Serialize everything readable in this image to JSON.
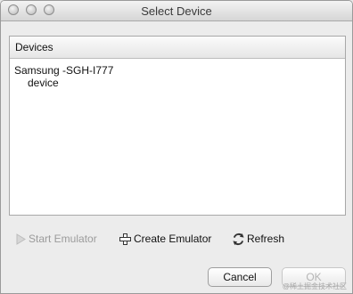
{
  "window": {
    "title": "Select Device"
  },
  "devices_panel": {
    "header": "Devices",
    "items": [
      {
        "name": "Samsung -SGH-I777",
        "serial": "device"
      }
    ]
  },
  "actions": {
    "start_emulator": "Start Emulator",
    "create_emulator": "Create Emulator",
    "refresh": "Refresh"
  },
  "buttons": {
    "cancel": "Cancel",
    "ok": "OK"
  },
  "watermark": "@稀土掘金技术社区"
}
